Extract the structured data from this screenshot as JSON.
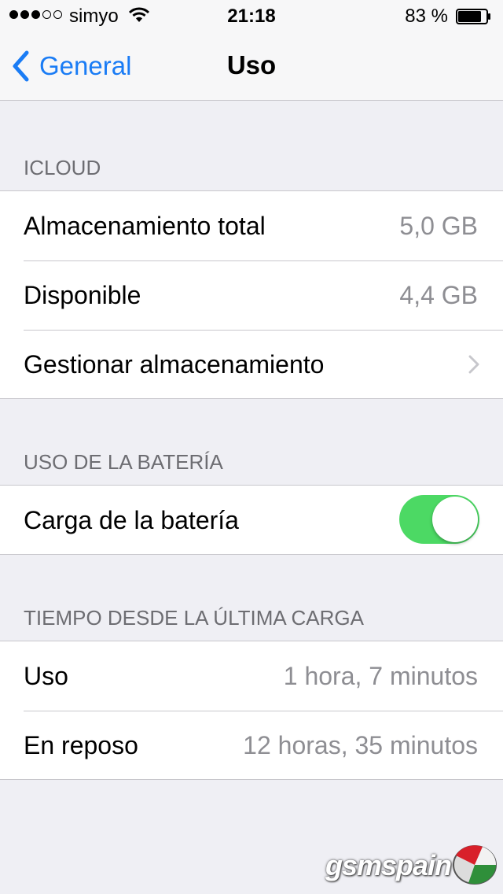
{
  "status_bar": {
    "signal_bars_filled": 3,
    "signal_bars_total": 5,
    "carrier": "simyo",
    "wifi_icon": "wifi-icon",
    "time": "21:18",
    "battery_percent_text": "83 %",
    "battery_level": 0.83
  },
  "nav": {
    "back_label": "General",
    "back_icon": "chevron-left-icon",
    "title": "Uso",
    "accent_color": "#1a7cf5"
  },
  "icloud": {
    "header": "ICLOUD",
    "rows": [
      {
        "label": "Almacenamiento total",
        "value": "5,0 GB"
      },
      {
        "label": "Disponible",
        "value": "4,4 GB"
      },
      {
        "label": "Gestionar almacenamiento"
      }
    ]
  },
  "battery_usage": {
    "header": "USO DE LA BATERÍA",
    "rows": [
      {
        "label": "Carga de la batería",
        "toggle_on": true,
        "toggle_color": "#4cd964"
      }
    ]
  },
  "since_last_charge": {
    "header": "TIEMPO DESDE LA ÚLTIMA CARGA",
    "rows": [
      {
        "label": "Uso",
        "value": "1 hora, 7 minutos"
      },
      {
        "label": "En reposo",
        "value": "12 horas, 35 minutos"
      }
    ]
  },
  "watermark": {
    "text": "gsmspain"
  }
}
